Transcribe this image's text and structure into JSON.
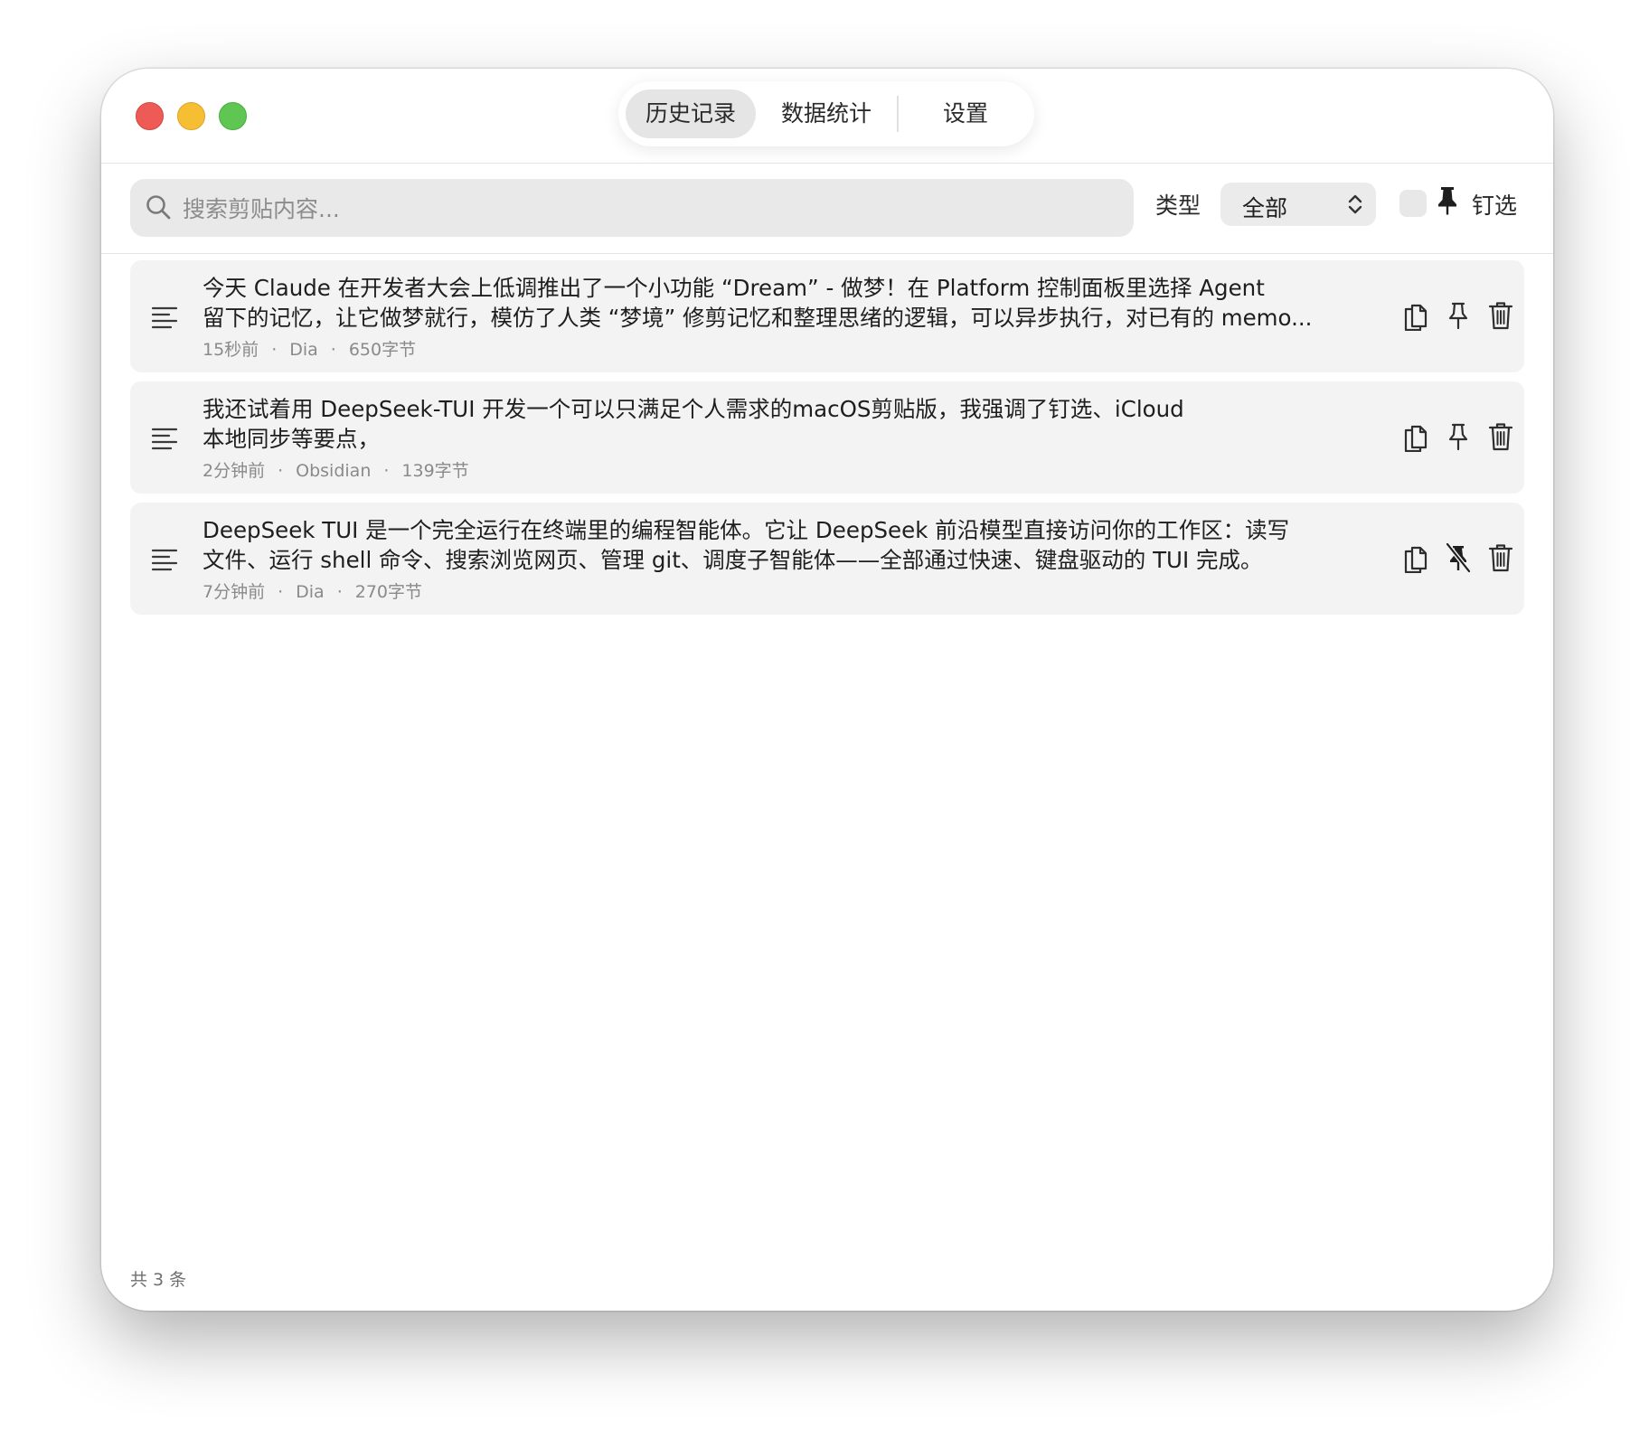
{
  "window": {
    "controls": [
      "close",
      "minimize",
      "zoom"
    ]
  },
  "tabs": {
    "history": "历史记录",
    "stats": "数据统计",
    "settings": "设置",
    "active": "history"
  },
  "toolbar": {
    "search_placeholder": "搜索剪贴内容...",
    "type_label": "类型",
    "type_value": "全部",
    "pin_filter_label": "钉选",
    "pin_filter_checked": false
  },
  "items": [
    {
      "text": "今天 Claude 在开发者大会上低调推出了一个小功能 “Dream” - 做梦！在 Platform 控制面板里选择 Agent\n留下的记忆，让它做梦就行，模仿了人类 “梦境” 修剪记忆和整理思绪的逻辑，可以异步执行，对已有的 memo...",
      "time": "15秒前",
      "source": "Dia",
      "size": "650字节",
      "pinned": false
    },
    {
      "text": "我还试着用 DeepSeek-TUI 开发一个可以只满足个人需求的macOS剪贴版，我强调了钉选、iCloud\n本地同步等要点，",
      "time": "2分钟前",
      "source": "Obsidian",
      "size": "139字节",
      "pinned": false
    },
    {
      "text": "DeepSeek TUI 是一个完全运行在终端里的编程智能体。它让 DeepSeek 前沿模型直接访问你的工作区：读写\n文件、运行 shell 命令、搜索浏览网页、管理 git、调度子智能体——全部通过快速、键盘驱动的 TUI 完成。",
      "time": "7分钟前",
      "source": "Dia",
      "size": "270字节",
      "pinned": true
    }
  ],
  "footer": {
    "count": "共 3 条"
  },
  "icons": {
    "search": "search-icon",
    "type_select": "chevron-up-down-icon",
    "pin_filter": "pin-icon",
    "item": "text-lines-icon",
    "copy": "copy-icon",
    "pin": "pin-icon",
    "unpin": "pin-slash-icon",
    "delete": "trash-icon"
  },
  "colors": {
    "close": "#ee5b57",
    "minimize": "#f5be33",
    "zoom": "#5fc653",
    "card_bg": "#f3f3f3",
    "active_tab_bg": "#e5e5e5"
  }
}
